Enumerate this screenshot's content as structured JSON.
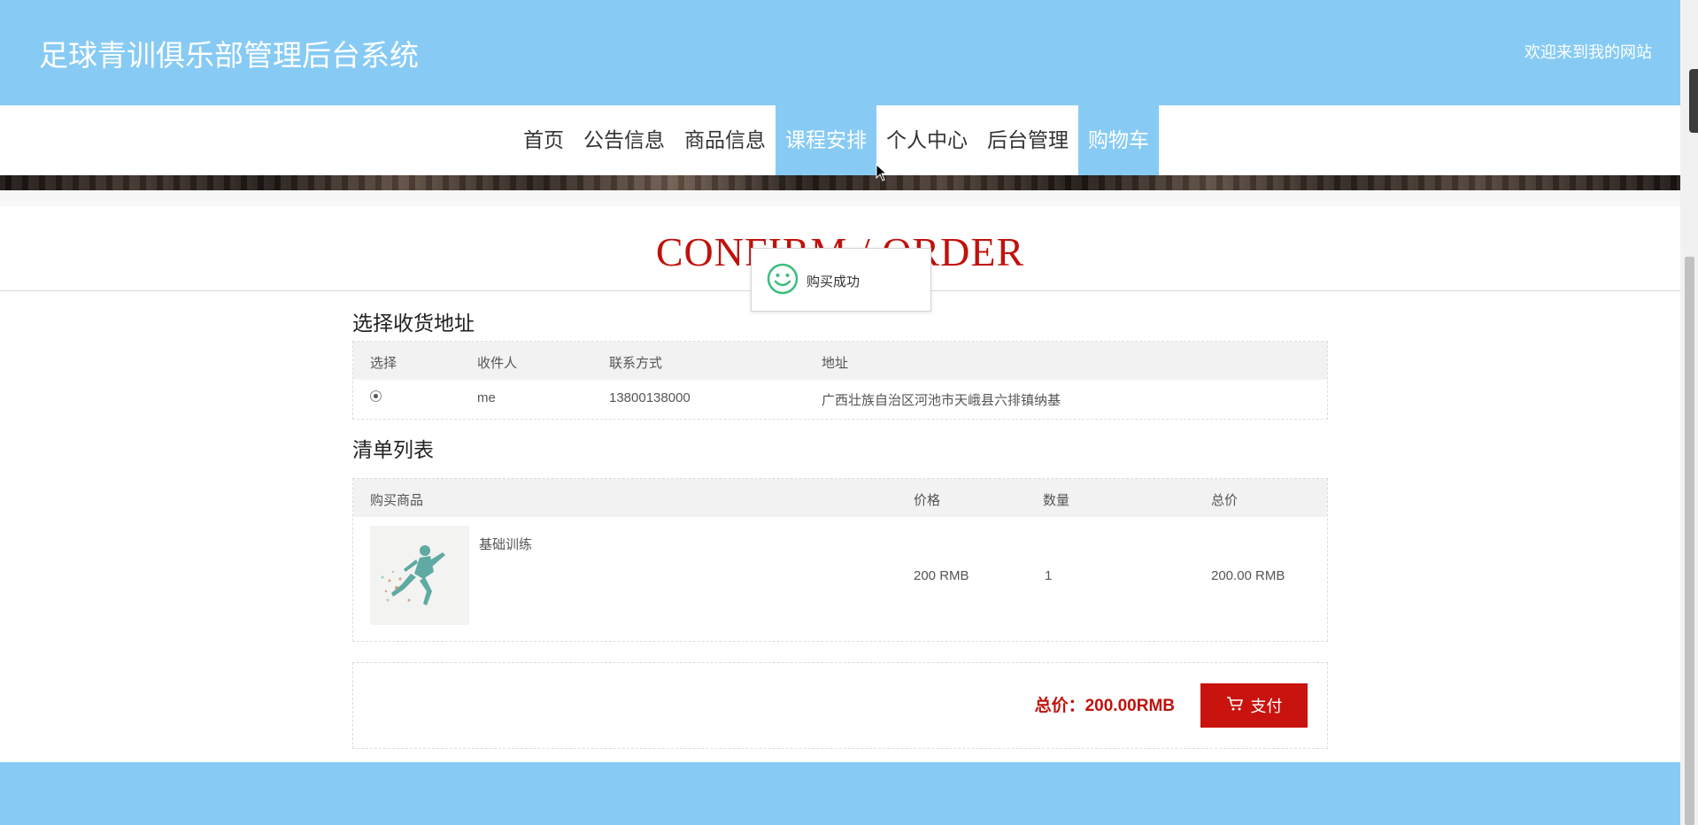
{
  "header": {
    "site_title": "足球青训俱乐部管理后台系统",
    "welcome": "欢迎来到我的网站",
    "bg_color": "#87cbf5"
  },
  "nav": {
    "items": [
      {
        "label": "首页",
        "active": false
      },
      {
        "label": "公告信息",
        "active": false
      },
      {
        "label": "商品信息",
        "active": false
      },
      {
        "label": "课程安排",
        "active": true
      },
      {
        "label": "个人中心",
        "active": false
      },
      {
        "label": "后台管理",
        "active": false
      },
      {
        "label": "购物车",
        "active": true
      }
    ]
  },
  "page_title": "CONFIRM / ORDER",
  "address_section": {
    "title": "选择收货地址",
    "columns": [
      "选择",
      "收件人",
      "联系方式",
      "地址"
    ],
    "rows": [
      {
        "selected": true,
        "recipient": "me",
        "phone": "13800138000",
        "address": "广西壮族自治区河池市天峨县六排镇纳基"
      }
    ]
  },
  "order_section": {
    "title": "清单列表",
    "columns": [
      "购买商品",
      "价格",
      "数量",
      "总价"
    ],
    "items": [
      {
        "name": "基础训练",
        "price": "200 RMB",
        "quantity": "1",
        "total": "200.00 RMB",
        "image": "runner-image"
      }
    ]
  },
  "summary": {
    "total_label": "总价：200.00RMB",
    "pay_label": "支付",
    "accent_color": "#c8130e"
  },
  "toast": {
    "message": "购买成功",
    "icon": "smile-icon"
  }
}
